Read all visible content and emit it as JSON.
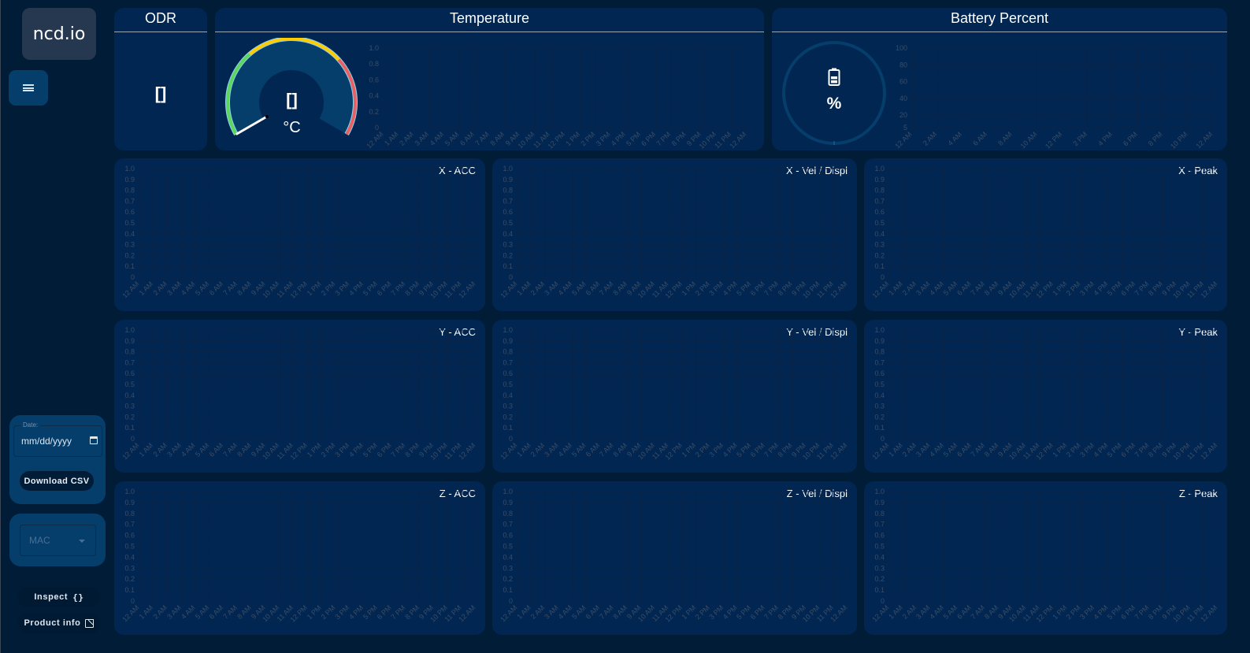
{
  "sidebar": {
    "logo": "ncd.io",
    "menu_icon": "hamburger-menu-icon",
    "date_label": "Date:",
    "date_value": "mm/dd/yyyy",
    "download_label": "Download CSV",
    "mac_placeholder": "MAC",
    "inspect_label": "Inspect",
    "inspect_icon": "{}",
    "product_info_label": "Product info"
  },
  "odr": {
    "title": "ODR",
    "value": "[]"
  },
  "temperature": {
    "title": "Temperature",
    "value": "[]",
    "unit": "°C",
    "gauge_segments": [
      {
        "color": "#5cd65c",
        "from": 0,
        "to": 0.33
      },
      {
        "color": "#ffcc00",
        "from": 0.33,
        "to": 0.7
      },
      {
        "color": "#e96060",
        "from": 0.7,
        "to": 1
      }
    ],
    "gauge_fraction": 0
  },
  "battery": {
    "title": "Battery Percent",
    "value": "%",
    "fraction": 0
  },
  "colors": {
    "page_bg": "#001c37",
    "card_bg": "#002651",
    "sidebar_accent": "#053d6b",
    "gauge_green": "#5cd65c",
    "gauge_yellow": "#ffcc00",
    "gauge_red": "#e96060"
  },
  "chart_data": [
    {
      "id": "temp",
      "type": "line",
      "title": "Temperature",
      "x": [
        "12 AM",
        "1 AM",
        "2 AM",
        "3 AM",
        "4 AM",
        "5 AM",
        "6 AM",
        "7 AM",
        "8 AM",
        "9 AM",
        "10 AM",
        "11 AM",
        "12 PM",
        "1 PM",
        "2 PM",
        "3 PM",
        "4 PM",
        "5 PM",
        "6 PM",
        "7 PM",
        "8 PM",
        "9 PM",
        "10 PM",
        "11 PM",
        "12 AM"
      ],
      "yticks": [
        "0",
        "0.2",
        "0.4",
        "0.6",
        "0.8",
        "1.0"
      ],
      "ylim": [
        0,
        1
      ],
      "series": [],
      "grid": true
    },
    {
      "id": "battery",
      "type": "line",
      "title": "Battery Percent",
      "x": [
        "12 AM",
        "2 AM",
        "4 AM",
        "6 AM",
        "8 AM",
        "10 AM",
        "12 PM",
        "2 PM",
        "4 PM",
        "6 PM",
        "8 PM",
        "10 PM",
        "12 AM"
      ],
      "yticks": [
        "5",
        "20",
        "40",
        "60",
        "80",
        "100"
      ],
      "ylim": [
        5,
        100
      ],
      "series": [],
      "grid": true
    },
    {
      "id": "x-acc",
      "type": "line",
      "title": "X - ACC",
      "ylim": [
        0,
        1
      ],
      "series": [],
      "grid": true
    },
    {
      "id": "x-vel",
      "type": "line",
      "title": "X - Vel / Displ",
      "ylim": [
        0,
        1
      ],
      "series": [],
      "grid": true
    },
    {
      "id": "x-peak",
      "type": "line",
      "title": "X - Peak",
      "ylim": [
        0,
        1
      ],
      "series": [],
      "grid": true
    },
    {
      "id": "y-acc",
      "type": "line",
      "title": "Y - ACC",
      "ylim": [
        0,
        1
      ],
      "series": [],
      "grid": true
    },
    {
      "id": "y-vel",
      "type": "line",
      "title": "Y - Vel / Displ",
      "ylim": [
        0,
        1
      ],
      "series": [],
      "grid": true
    },
    {
      "id": "y-peak",
      "type": "line",
      "title": "Y - Peak",
      "ylim": [
        0,
        1
      ],
      "series": [],
      "grid": true
    },
    {
      "id": "z-acc",
      "type": "line",
      "title": "Z - ACC",
      "ylim": [
        0,
        1
      ],
      "series": [],
      "grid": true
    },
    {
      "id": "z-vel",
      "type": "line",
      "title": "Z - Vel / Displ",
      "ylim": [
        0,
        1
      ],
      "series": [],
      "grid": true
    },
    {
      "id": "z-peak",
      "type": "line",
      "title": "Z - Peak",
      "ylim": [
        0,
        1
      ],
      "series": [],
      "grid": true
    }
  ],
  "plot_axes": {
    "x": [
      "12 AM",
      "1 AM",
      "2 AM",
      "3 AM",
      "4 AM",
      "5 AM",
      "6 AM",
      "7 AM",
      "8 AM",
      "9 AM",
      "10 AM",
      "11 AM",
      "12 PM",
      "1 PM",
      "2 PM",
      "3 PM",
      "4 PM",
      "5 PM",
      "6 PM",
      "7 PM",
      "8 PM",
      "9 PM",
      "10 PM",
      "11 PM",
      "12 AM"
    ],
    "yticks": [
      "0",
      "0.1",
      "0.2",
      "0.3",
      "0.4",
      "0.5",
      "0.6",
      "0.7",
      "0.8",
      "0.9",
      "1.0"
    ]
  }
}
